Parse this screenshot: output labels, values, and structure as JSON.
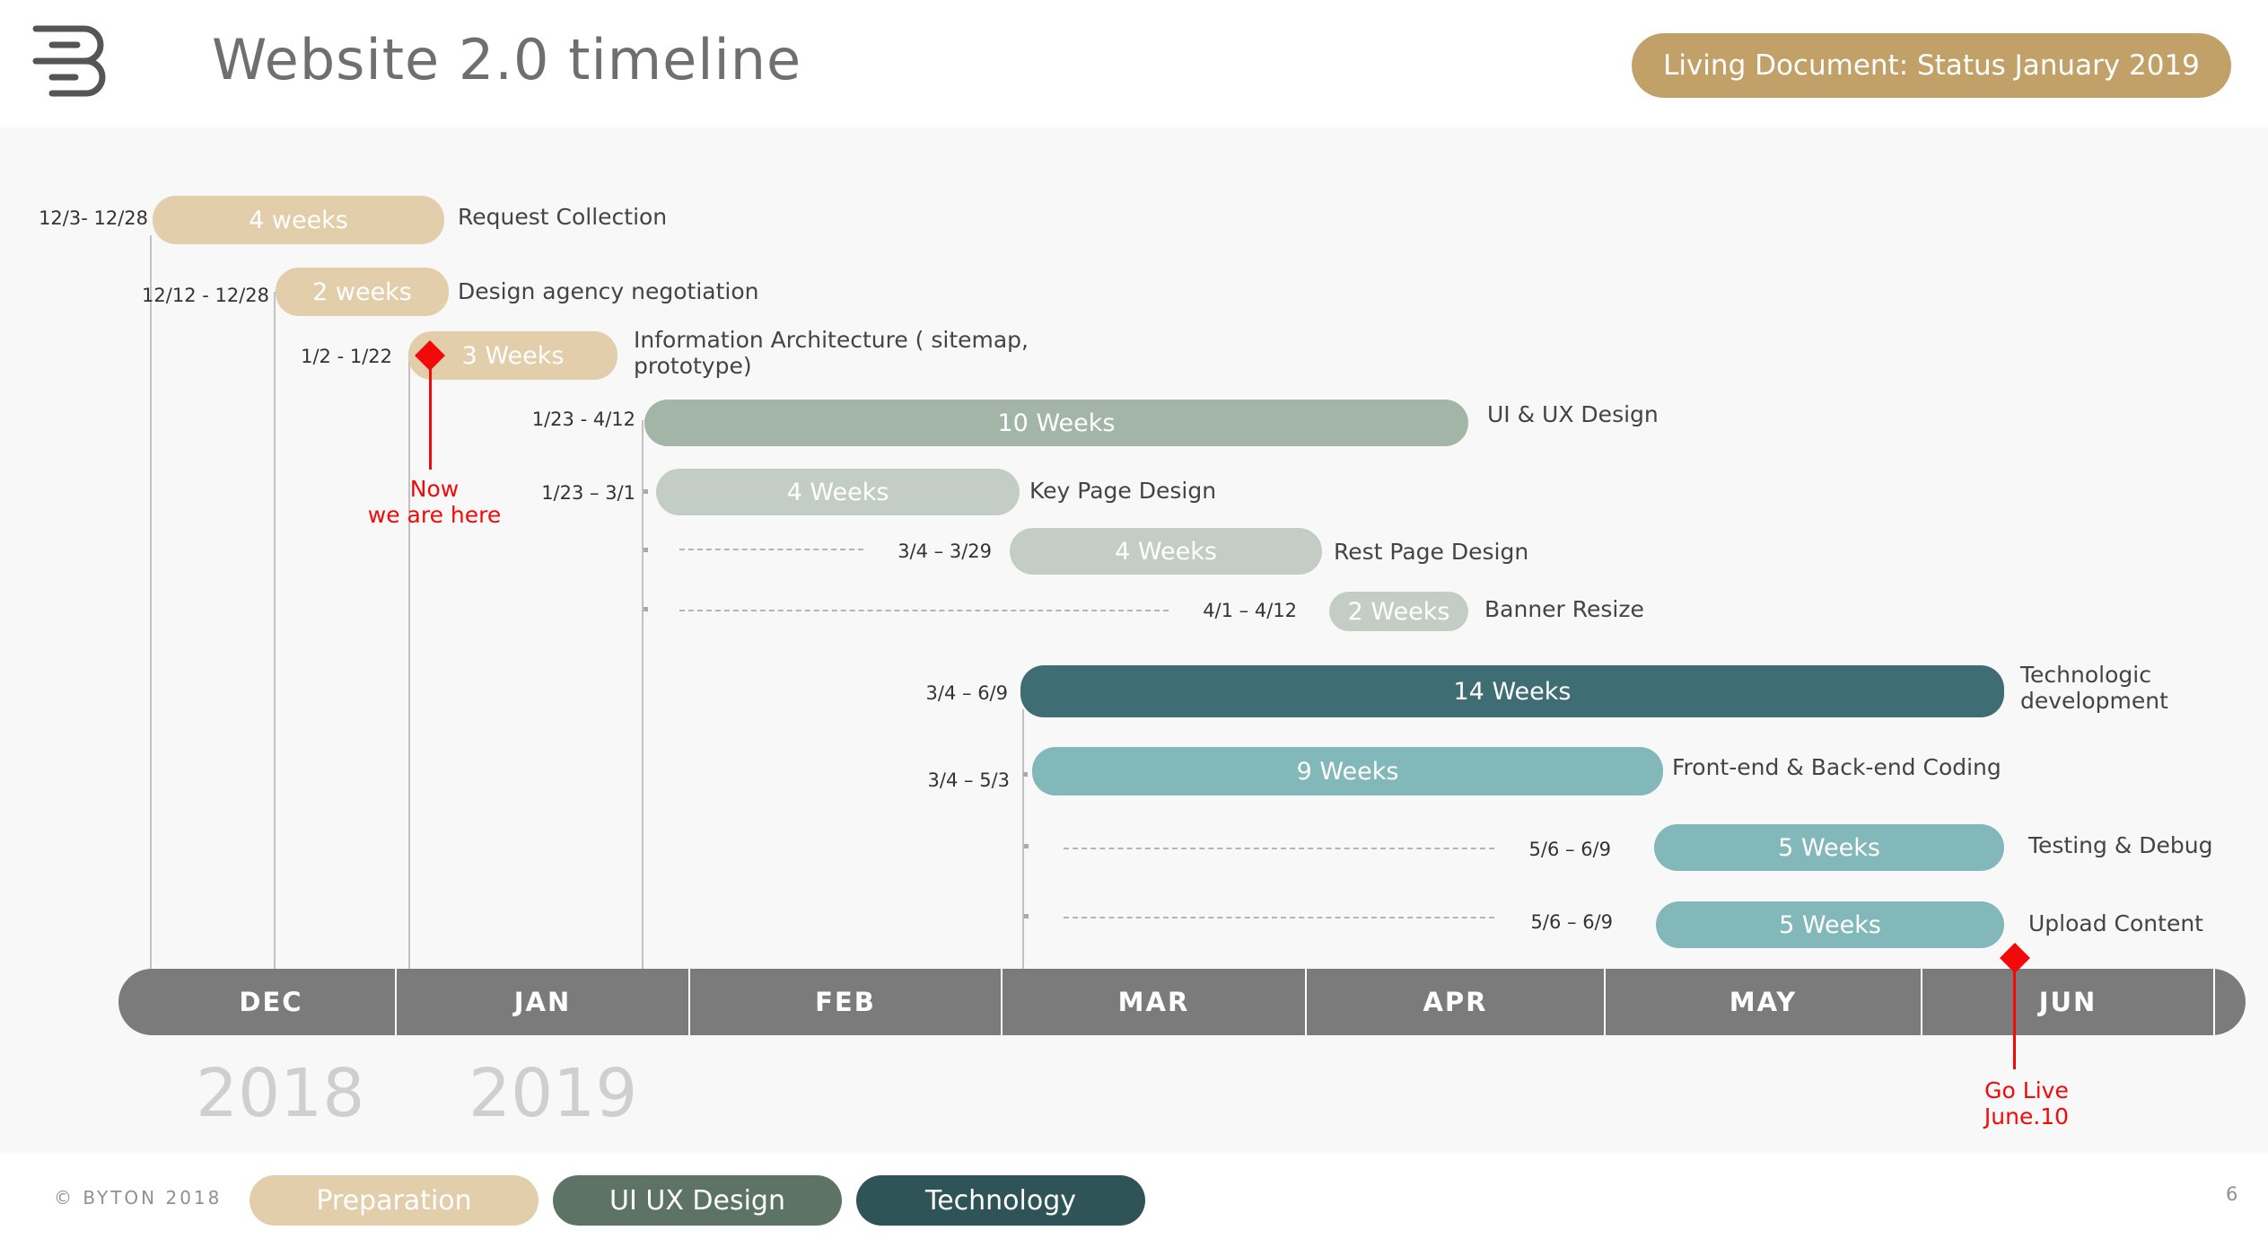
{
  "header": {
    "title": "Website 2.0 timeline",
    "status": "Living Document: Status January 2019",
    "logo_icon": "byton-logo-icon"
  },
  "tasks": [
    {
      "dates": "12/3- 12/28",
      "duration": "4 weeks",
      "name": "Request Collection",
      "category": "Preparation"
    },
    {
      "dates": "12/12 - 12/28",
      "duration": "2  weeks",
      "name": "Design agency negotiation",
      "category": "Preparation"
    },
    {
      "dates": "1/2 - 1/22",
      "duration": "3 Weeks",
      "name_line1": "Information Architecture ( sitemap,",
      "name_line2": "prototype)",
      "category": "Preparation"
    },
    {
      "dates": "1/23 - 4/12",
      "duration": "10 Weeks",
      "name": "UI & UX  Design",
      "category": "UI UX Design"
    },
    {
      "dates": "1/23 – 3/1",
      "duration": "4 Weeks",
      "name": "Key Page Design",
      "category": "UI UX Design"
    },
    {
      "dates": "3/4 – 3/29",
      "duration": "4 Weeks",
      "name": "Rest Page Design",
      "category": "UI UX Design"
    },
    {
      "dates": "4/1 – 4/12",
      "duration": "2 Weeks",
      "name": "Banner Resize",
      "category": "UI UX Design"
    },
    {
      "dates": "3/4 – 6/9",
      "duration": "14 Weeks",
      "name_line1": "Technologic",
      "name_line2": "development",
      "category": "Technology"
    },
    {
      "dates": "3/4 – 5/3",
      "duration": "9 Weeks",
      "name": "Front-end & Back-end Coding",
      "category": "Technology"
    },
    {
      "dates": "5/6 – 6/9",
      "duration": "5 Weeks",
      "name": "Testing & Debug",
      "category": "Technology"
    },
    {
      "dates": "5/6 – 6/9",
      "duration": "5 Weeks",
      "name": "Upload Content",
      "category": "Technology"
    }
  ],
  "timeline": {
    "months": [
      "DEC",
      "JAN",
      "FEB",
      "MAR",
      "APR",
      "MAY",
      "JUN"
    ],
    "years": [
      "2018",
      "2019"
    ]
  },
  "markers": {
    "now_line1": "Now",
    "now_line2": "we are here",
    "golive_line1": "Go Live",
    "golive_line2": "June.10"
  },
  "footer": {
    "copyright": "© BYTON 2018",
    "legend": [
      "Preparation",
      "UI UX Design",
      "Technology"
    ],
    "page_number": "6"
  },
  "colors": {
    "preparation": "#e2ceaa",
    "ui_ux_design": "#a2b5a6",
    "ui_ux_light": "#c3cdc5",
    "technology": "#3e6e73",
    "technology_light": "#83b8ba",
    "legend_ui_ux": "#5d7365",
    "legend_technology": "#2f5457",
    "status_pill": "#c1a168",
    "marker_red": "#f20a0a",
    "axis": "#7b7b7b"
  }
}
